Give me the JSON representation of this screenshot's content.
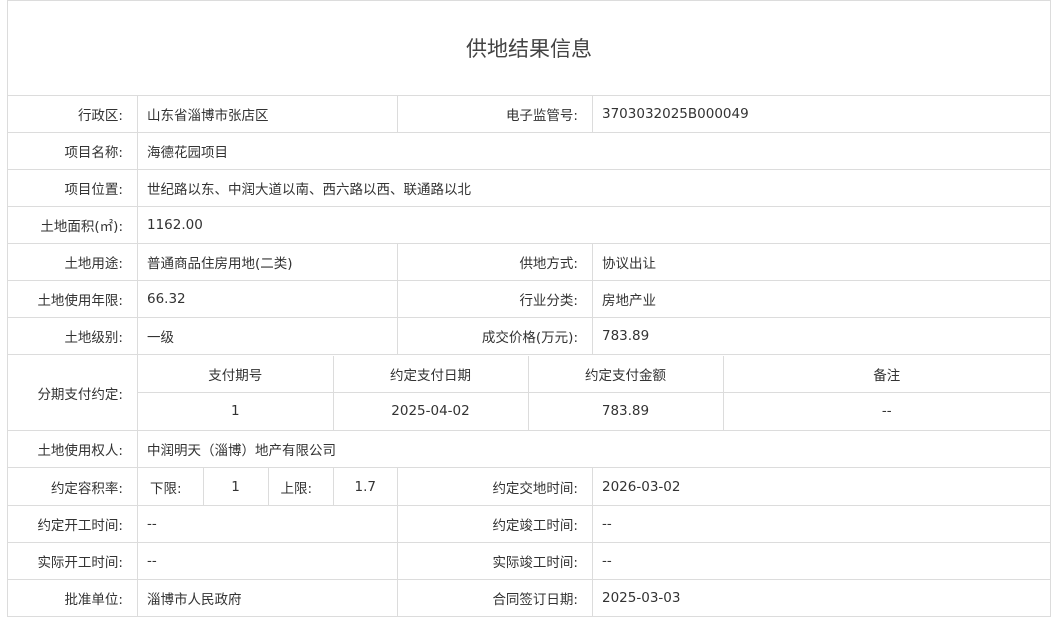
{
  "title": "供地结果信息",
  "admin_region": {
    "label": "行政区:",
    "value": "山东省淄博市张店区"
  },
  "supervision_no": {
    "label": "电子监管号:",
    "value": "3703032025B000049"
  },
  "project_name": {
    "label": "项目名称:",
    "value": "海德花园项目"
  },
  "project_location": {
    "label": "项目位置:",
    "value": "世纪路以东、中润大道以南、西六路以西、联通路以北"
  },
  "land_area": {
    "label": "土地面积(㎡):",
    "value": "1162.00"
  },
  "land_use": {
    "label": "土地用途:",
    "value": "普通商品住房用地(二类)"
  },
  "supply_method": {
    "label": "供地方式:",
    "value": "协议出让"
  },
  "use_years": {
    "label": "土地使用年限:",
    "value": "66.32"
  },
  "industry": {
    "label": "行业分类:",
    "value": "房地产业"
  },
  "land_grade": {
    "label": "土地级别:",
    "value": "一级"
  },
  "deal_price": {
    "label": "成交价格(万元):",
    "value": "783.89"
  },
  "installments": {
    "label": "分期支付约定:",
    "headers": [
      "支付期号",
      "约定支付日期",
      "约定支付金额",
      "备注"
    ],
    "rows": [
      [
        "1",
        "2025-04-02",
        "783.89",
        "--"
      ]
    ]
  },
  "land_owner": {
    "label": "土地使用权人:",
    "value": "中润明天（淄博）地产有限公司"
  },
  "far": {
    "label": "约定容积率:",
    "lower_label": "下限:",
    "lower": "1",
    "upper_label": "上限:",
    "upper": "1.7"
  },
  "handover_time": {
    "label": "约定交地时间:",
    "value": "2026-03-02"
  },
  "planned_start": {
    "label": "约定开工时间:",
    "value": "--"
  },
  "planned_finish": {
    "label": "约定竣工时间:",
    "value": "--"
  },
  "actual_start": {
    "label": "实际开工时间:",
    "value": "--"
  },
  "actual_finish": {
    "label": "实际竣工时间:",
    "value": "--"
  },
  "approver": {
    "label": "批准单位:",
    "value": "淄博市人民政府"
  },
  "contract_date": {
    "label": "合同签订日期:",
    "value": "2025-03-03"
  }
}
